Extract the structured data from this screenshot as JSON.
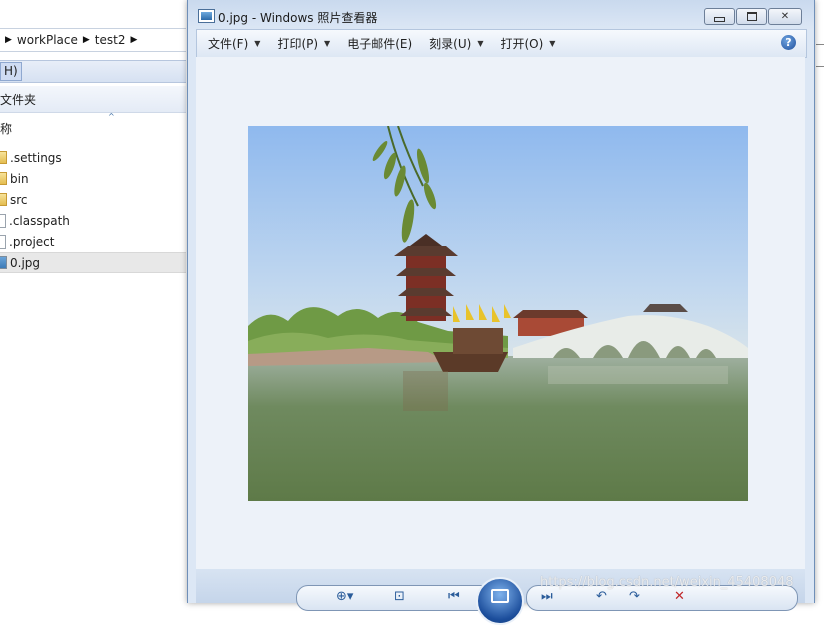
{
  "explorer": {
    "breadcrumb": [
      "workPlace",
      "test2"
    ],
    "menu_fragment": "H)",
    "toolbar_fragment": "文件夹",
    "column_header": "称",
    "files": [
      {
        "name": ".settings",
        "type": "folder"
      },
      {
        "name": "bin",
        "type": "folder"
      },
      {
        "name": "src",
        "type": "folder"
      },
      {
        "name": ".classpath",
        "type": "file"
      },
      {
        "name": ".project",
        "type": "file"
      },
      {
        "name": "0.jpg",
        "type": "image",
        "selected": true
      }
    ]
  },
  "viewer": {
    "title": "0.jpg - Windows 照片查看器",
    "menus": [
      {
        "label": "文件(F)",
        "has_dropdown": true
      },
      {
        "label": "打印(P)",
        "has_dropdown": true
      },
      {
        "label": "电子邮件(E)",
        "has_dropdown": false
      },
      {
        "label": "刻录(U)",
        "has_dropdown": true
      },
      {
        "label": "打开(O)",
        "has_dropdown": true
      }
    ],
    "help_icon": "?",
    "window_buttons": {
      "minimize": "minimize-icon",
      "maximize": "maximize-icon",
      "close": "✕"
    },
    "toolbar_icons": {
      "zoom": "⊕▾",
      "actual_size": "⊡",
      "previous": "⏮",
      "next": "⏭",
      "rotate_left": "↶",
      "rotate_right": "↷",
      "delete": "✕"
    }
  },
  "watermark": "https://blog.csdn.net/weixin_45408048",
  "colors": {
    "viewer_bg": "#dce7f5",
    "canvas_bg": "#edf2f9",
    "accent": "#2a5c9a",
    "delete_red": "#c0282a"
  }
}
